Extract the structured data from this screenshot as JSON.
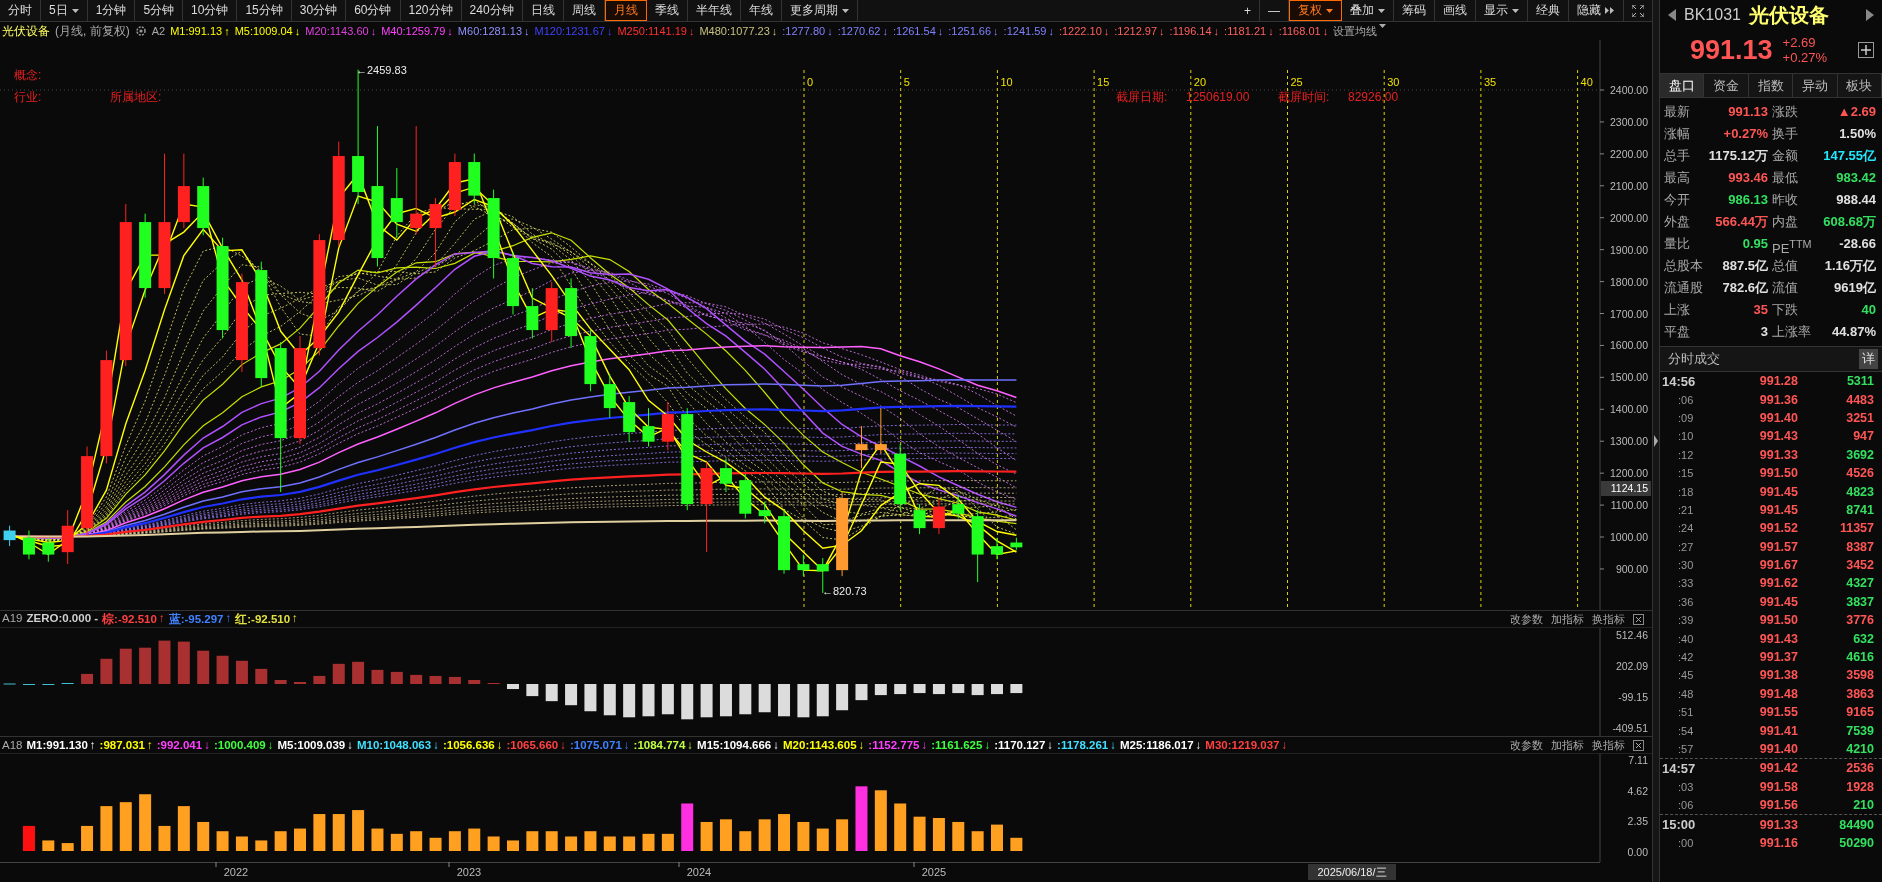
{
  "toolbar": {
    "periods": [
      {
        "label": "分时",
        "selected": false,
        "kind": "plain"
      },
      {
        "label": "5日",
        "selected": false,
        "kind": "menu"
      },
      {
        "label": "1分钟",
        "selected": false,
        "kind": "plain"
      },
      {
        "label": "5分钟",
        "selected": false,
        "kind": "plain"
      },
      {
        "label": "10分钟",
        "selected": false,
        "kind": "plain"
      },
      {
        "label": "15分钟",
        "selected": false,
        "kind": "plain"
      },
      {
        "label": "30分钟",
        "selected": false,
        "kind": "plain"
      },
      {
        "label": "60分钟",
        "selected": false,
        "kind": "plain"
      },
      {
        "label": "120分钟",
        "selected": false,
        "kind": "plain"
      },
      {
        "label": "240分钟",
        "selected": false,
        "kind": "plain"
      },
      {
        "label": "日线",
        "selected": false,
        "kind": "plain"
      },
      {
        "label": "周线",
        "selected": false,
        "kind": "plain"
      },
      {
        "label": "月线",
        "selected": true,
        "kind": "plain"
      },
      {
        "label": "季线",
        "selected": false,
        "kind": "plain"
      },
      {
        "label": "半年线",
        "selected": false,
        "kind": "plain"
      },
      {
        "label": "年线",
        "selected": false,
        "kind": "plain"
      },
      {
        "label": "更多周期",
        "selected": false,
        "kind": "menu"
      }
    ],
    "tools": [
      {
        "label": "+",
        "selected": false,
        "kind": "plain"
      },
      {
        "label": "—",
        "selected": false,
        "kind": "plain"
      },
      {
        "label": "复权",
        "selected": true,
        "kind": "menu"
      },
      {
        "label": "叠加",
        "selected": false,
        "kind": "menu"
      },
      {
        "label": "筹码",
        "selected": false,
        "kind": "plain"
      },
      {
        "label": "画线",
        "selected": false,
        "kind": "plain"
      },
      {
        "label": "显示",
        "selected": false,
        "kind": "menu"
      },
      {
        "label": "经典",
        "selected": false,
        "kind": "plain"
      },
      {
        "label": "隐藏",
        "selected": false,
        "kind": "collapse"
      }
    ]
  },
  "legend": {
    "title": "光伏设备",
    "subtitle": "(月线, 前复权)",
    "formula": "A2",
    "settings": "设置均线",
    "averages": [
      {
        "label": "M1:991.13",
        "arrow": "↑",
        "color": "#ffff00"
      },
      {
        "label": "M5:1009.04",
        "arrow": "↓",
        "color": "#ffff00"
      },
      {
        "label": "M20:1143.60",
        "arrow": "↓",
        "color": "#e040e0"
      },
      {
        "label": "M40:1259.79",
        "arrow": "↓",
        "color": "#ff40ff"
      },
      {
        "label": "M60:1281.13",
        "arrow": "↓",
        "color": "#9090ff"
      },
      {
        "label": "M120:1231.67",
        "arrow": "↓",
        "color": "#4040ff"
      },
      {
        "label": "M250:1141.19",
        "arrow": "↓",
        "color": "#ff3030"
      },
      {
        "label": "M480:1077.23",
        "arrow": "↓",
        "color": "#c8c080"
      },
      {
        "label": ":1277.80",
        "arrow": "↓",
        "color": "#8080ff"
      },
      {
        "label": ":1270.62",
        "arrow": "↓",
        "color": "#8080ff"
      },
      {
        "label": ":1261.54",
        "arrow": "↓",
        "color": "#8080ff"
      },
      {
        "label": ":1251.66",
        "arrow": "↓",
        "color": "#8080ff"
      },
      {
        "label": ":1241.59",
        "arrow": "↓",
        "color": "#8080ff"
      },
      {
        "label": ":1222.10",
        "arrow": "↓",
        "color": "#ff6060"
      },
      {
        "label": ":1212.97",
        "arrow": "↓",
        "color": "#ff6060"
      },
      {
        "label": ":1196.14",
        "arrow": "↓",
        "color": "#ff6060"
      },
      {
        "label": ":1181.21",
        "arrow": "↓",
        "color": "#ff6060"
      },
      {
        "label": ":1168.01",
        "arrow": "↓",
        "color": "#ff6060"
      }
    ]
  },
  "main_chart": {
    "info": [
      {
        "label": "概念:"
      },
      {
        "label": "行业:"
      },
      {
        "label": "所属地区:"
      }
    ],
    "capture": [
      {
        "label": "截屏日期:",
        "value": "1250619.00"
      },
      {
        "label": "截屏时间:",
        "value": "82926.00"
      }
    ],
    "countdown_marks": [
      "0",
      "5",
      "10",
      "15",
      "20",
      "25",
      "30",
      "35",
      "40"
    ],
    "high_marker": "←2459.83",
    "low_marker": "←820.73",
    "price_axis": [
      "2400.00",
      "2300.00",
      "2200.00",
      "2100.00",
      "2000.00",
      "1900.00",
      "1800.00",
      "1700.00",
      "1600.00",
      "1500.00",
      "1400.00",
      "1300.00",
      "1200.00",
      "1100.00",
      "1000.00",
      "900.00"
    ],
    "crosshair_price": "1124.15"
  },
  "macd_panel": {
    "name": "A19",
    "items": [
      {
        "label": "ZERO:0.000 -",
        "color": "#d0d0d0"
      },
      {
        "label": "棕:-92.510",
        "arrow": "↑",
        "color": "#ff4040"
      },
      {
        "label": "蓝:-95.297",
        "arrow": "↑",
        "color": "#4080ff"
      },
      {
        "label": "红:-92.510",
        "arrow": "↑",
        "color": "#e0e040"
      }
    ],
    "actions": [
      "改参数",
      "加指标",
      "换指标"
    ],
    "axis": [
      "512.46",
      "202.09",
      "-99.15",
      "-409.51"
    ]
  },
  "volume_panel": {
    "name": "A18",
    "items": [
      {
        "label": "M1:991.130",
        "arrow": "↑",
        "color": "#ffffff"
      },
      {
        "label": ":987.031",
        "arrow": "↑",
        "color": "#ffff00"
      },
      {
        "label": ":992.041",
        "arrow": "↓",
        "color": "#ff40ff"
      },
      {
        "label": ":1000.409",
        "arrow": "↓",
        "color": "#40ff40"
      },
      {
        "label": "M5:1009.039",
        "arrow": "↓",
        "color": "#ffffff"
      },
      {
        "label": "M10:1048.063",
        "arrow": "↓",
        "color": "#40e0ff"
      },
      {
        "label": ":1056.636",
        "arrow": "↓",
        "color": "#ffff00"
      },
      {
        "label": ":1065.660",
        "arrow": "↓",
        "color": "#ff4040"
      },
      {
        "label": ":1075.071",
        "arrow": "↓",
        "color": "#4080ff"
      },
      {
        "label": ":1084.774",
        "arrow": "↓",
        "color": "#c0ff40"
      },
      {
        "label": "M15:1094.666",
        "arrow": "↓",
        "color": "#ffffff"
      },
      {
        "label": "M20:1143.605",
        "arrow": "↓",
        "color": "#ffff00"
      },
      {
        "label": ":1152.775",
        "arrow": "↓",
        "color": "#ff40ff"
      },
      {
        "label": ":1161.625",
        "arrow": "↓",
        "color": "#40ff40"
      },
      {
        "label": ":1170.127",
        "arrow": "↓",
        "color": "#ffffff"
      },
      {
        "label": ":1178.261",
        "arrow": "↓",
        "color": "#40e0ff"
      },
      {
        "label": "M25:1186.017",
        "arrow": "↓",
        "color": "#ffffff"
      },
      {
        "label": "M30:1219.037",
        "arrow": "↓",
        "color": "#ff4040"
      }
    ],
    "actions": [
      "改参数",
      "加指标",
      "换指标"
    ],
    "axis": [
      "7.11",
      "4.62",
      "2.35",
      "0.00"
    ]
  },
  "time_axis": {
    "years": [
      "2022",
      "2023",
      "2024",
      "2025"
    ],
    "cursor_date": "2025/06/18/三"
  },
  "quote": {
    "code": "BK1031",
    "name": "光伏设备",
    "price": "991.13",
    "change": "+2.69",
    "change_pct": "+0.27%"
  },
  "tabs": [
    {
      "label": "盘口",
      "selected": true
    },
    {
      "label": "资金",
      "selected": false
    },
    {
      "label": "指数",
      "selected": false
    },
    {
      "label": "异动",
      "selected": false
    },
    {
      "label": "板块",
      "selected": false
    }
  ],
  "stats": [
    {
      "label": "最新",
      "value": "991.13",
      "color": "#ff5555"
    },
    {
      "label": "涨跌",
      "value": "▲2.69",
      "color": "#ff5555"
    },
    {
      "label": "涨幅",
      "value": "+0.27%",
      "color": "#ff5555"
    },
    {
      "label": "换手",
      "value": "1.50%",
      "color": "#e0e0e0"
    },
    {
      "label": "总手",
      "value": "1175.12万",
      "color": "#e0e0e0"
    },
    {
      "label": "金额",
      "value": "147.55亿",
      "color": "#20e8ff"
    },
    {
      "label": "最高",
      "value": "993.46",
      "color": "#ff5555"
    },
    {
      "label": "最低",
      "value": "983.42",
      "color": "#33e060"
    },
    {
      "label": "今开",
      "value": "986.13",
      "color": "#33e060"
    },
    {
      "label": "昨收",
      "value": "988.44",
      "color": "#e0e0e0"
    },
    {
      "label": "外盘",
      "value": "566.44万",
      "color": "#ff5555"
    },
    {
      "label": "内盘",
      "value": "608.68万",
      "color": "#33e060"
    },
    {
      "label": "量比",
      "value": "0.95",
      "color": "#33e060"
    },
    {
      "label": "PE$^{TTM}$",
      "value": "-28.66",
      "color": "#e0e0e0"
    },
    {
      "label": "总股本",
      "value": "887.5亿",
      "color": "#e0e0e0"
    },
    {
      "label": "总值",
      "value": "1.16万亿",
      "color": "#e0e0e0"
    },
    {
      "label": "流通股",
      "value": "782.6亿",
      "color": "#e0e0e0"
    },
    {
      "label": "流值",
      "value": "9619亿",
      "color": "#e0e0e0"
    },
    {
      "label": "上涨",
      "value": "35",
      "color": "#ff5555"
    },
    {
      "label": "下跌",
      "value": "40",
      "color": "#33e060"
    },
    {
      "label": "平盘",
      "value": "3",
      "color": "#e0e0e0"
    },
    {
      "label": "上涨率",
      "value": "44.87%",
      "color": "#e0e0e0"
    }
  ],
  "trades": {
    "title": "分时成交",
    "detail": "详",
    "rows": [
      {
        "time": "14:56",
        "kind": "minute",
        "price": "991.28",
        "volume": "5311",
        "color": "#33e060"
      },
      {
        "time": ":06",
        "kind": "second",
        "price": "991.36",
        "volume": "4483",
        "color": "#ff5555"
      },
      {
        "time": ":09",
        "kind": "second",
        "price": "991.40",
        "volume": "3251",
        "color": "#ff5555"
      },
      {
        "time": ":10",
        "kind": "second",
        "price": "991.43",
        "volume": "947",
        "color": "#ff5555"
      },
      {
        "time": ":12",
        "kind": "second",
        "price": "991.33",
        "volume": "3692",
        "color": "#33e060"
      },
      {
        "time": ":15",
        "kind": "second",
        "price": "991.50",
        "volume": "4526",
        "color": "#ff5555"
      },
      {
        "time": ":18",
        "kind": "second",
        "price": "991.45",
        "volume": "4823",
        "color": "#33e060"
      },
      {
        "time": ":21",
        "kind": "second",
        "price": "991.45",
        "volume": "8741",
        "color": "#33e060"
      },
      {
        "time": ":24",
        "kind": "second",
        "price": "991.52",
        "volume": "11357",
        "color": "#ff5555"
      },
      {
        "time": ":27",
        "kind": "second",
        "price": "991.57",
        "volume": "8387",
        "color": "#ff5555"
      },
      {
        "time": ":30",
        "kind": "second",
        "price": "991.67",
        "volume": "3452",
        "color": "#ff5555"
      },
      {
        "time": ":33",
        "kind": "second",
        "price": "991.62",
        "volume": "4327",
        "color": "#33e060"
      },
      {
        "time": ":36",
        "kind": "second",
        "price": "991.45",
        "volume": "3837",
        "color": "#33e060"
      },
      {
        "time": ":39",
        "kind": "second",
        "price": "991.50",
        "volume": "3776",
        "color": "#ff5555"
      },
      {
        "time": ":40",
        "kind": "second",
        "price": "991.43",
        "volume": "632",
        "color": "#33e060"
      },
      {
        "time": ":42",
        "kind": "second",
        "price": "991.37",
        "volume": "4616",
        "color": "#33e060"
      },
      {
        "time": ":45",
        "kind": "second",
        "price": "991.38",
        "volume": "3598",
        "color": "#ff5555"
      },
      {
        "time": ":48",
        "kind": "second",
        "price": "991.48",
        "volume": "3863",
        "color": "#ff5555"
      },
      {
        "time": ":51",
        "kind": "second",
        "price": "991.55",
        "volume": "9165",
        "color": "#ff5555"
      },
      {
        "time": ":54",
        "kind": "second",
        "price": "991.41",
        "volume": "7539",
        "color": "#33e060"
      },
      {
        "time": ":57",
        "kind": "second",
        "price": "991.40",
        "volume": "4210",
        "color": "#33e060"
      },
      {
        "time": "14:57",
        "kind": "minute",
        "price": "991.42",
        "volume": "2536",
        "color": "#ff5555"
      },
      {
        "time": ":03",
        "kind": "second",
        "price": "991.58",
        "volume": "1928",
        "color": "#ff5555"
      },
      {
        "time": ":06",
        "kind": "second",
        "price": "991.56",
        "volume": "210",
        "color": "#33e060"
      },
      {
        "time": "15:00",
        "kind": "minute",
        "price": "991.33",
        "volume": "84490",
        "color": "#33e060"
      },
      {
        "time": ":00",
        "kind": "second",
        "price": "991.16",
        "volume": "50290",
        "color": "#33e060"
      }
    ]
  }
}
